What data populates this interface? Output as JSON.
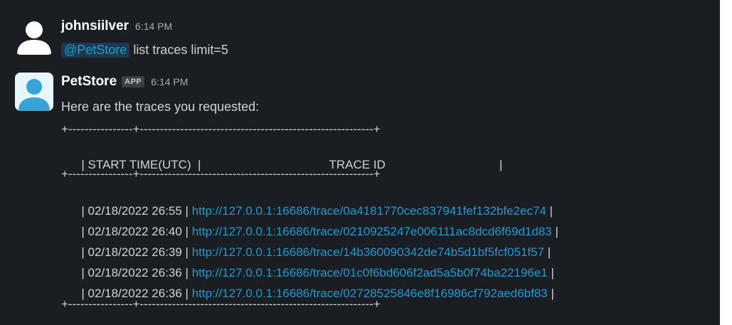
{
  "messages": [
    {
      "sender": "johnsiilver",
      "time": "6:14 PM",
      "mention": "@PetStore",
      "text": " list traces limit=5"
    },
    {
      "sender": "PetStore",
      "badge": "APP",
      "time": "6:14 PM",
      "text": "Here are the traces you requested:",
      "table": {
        "border": "+----------------+----------------------------------------------------------+",
        "header": {
          "start": "| START TIME(UTC)  |",
          "trace": "TRACE ID",
          "end": "|"
        },
        "rows": [
          {
            "time": "| 02/18/2022 26:55 | ",
            "url": "http://127.0.0.1:16686/trace/0a4181770cec837941fef132bfe2ec74",
            "end": " |"
          },
          {
            "time": "| 02/18/2022 26:40 | ",
            "url": "http://127.0.0.1:16686/trace/0210925247e006111ac8dcd6f69d1d83",
            "end": " |"
          },
          {
            "time": "| 02/18/2022 26:39 | ",
            "url": "http://127.0.0.1:16686/trace/14b360090342de74b5d1bf5fcf051f57",
            "end": " |"
          },
          {
            "time": "| 02/18/2022 26:36 | ",
            "url": "http://127.0.0.1:16686/trace/01c0f6bd606f2ad5a5b0f74ba22196e1",
            "end": " |"
          },
          {
            "time": "| 02/18/2022 26:36 | ",
            "url": "http://127.0.0.1:16686/trace/02728525846e8f16986cf792aed6bf83",
            "end": " |"
          }
        ]
      }
    }
  ],
  "colors": {
    "background": "#1a1d21",
    "text": "#d1d2d3",
    "link": "#1d9bd1",
    "mention_bg": "#1d3a4d",
    "bot_avatar": "#36a4d6"
  },
  "icons": {
    "user_avatar": "user-silhouette-icon",
    "bot_avatar": "bot-avatar-icon"
  }
}
